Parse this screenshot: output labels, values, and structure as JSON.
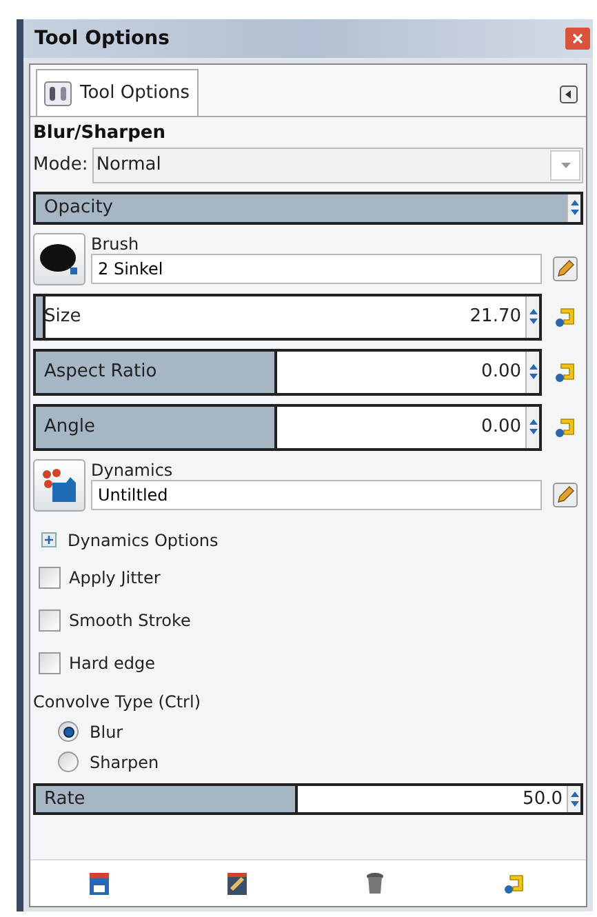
{
  "window": {
    "title": "Tool Options"
  },
  "tab": {
    "label": "Tool Options",
    "selected": true
  },
  "tool_name": "Blur/Sharpen",
  "mode": {
    "label": "Mode:",
    "value": "Normal"
  },
  "opacity": {
    "label": "Opacity",
    "level": 1
  },
  "brush": {
    "label": "Brush",
    "value": "2 Sinkel"
  },
  "sliders": [
    {
      "label": "Size",
      "value": "21.70",
      "level": 0.02
    },
    {
      "label": "Aspect Ratio",
      "value": "0.00",
      "level": 0.48
    },
    {
      "label": "Angle",
      "value": "0.00",
      "level": 0.48
    }
  ],
  "dynamics": {
    "label": "Dynamics",
    "value": "Untiltled"
  },
  "dynamics_options": {
    "label": "Dynamics Options",
    "expanded": false
  },
  "checkboxes": [
    {
      "label": "Apply Jitter",
      "checked": false
    },
    {
      "label": "Smooth Stroke",
      "checked": false
    },
    {
      "label": "Hard edge",
      "checked": false
    }
  ],
  "convolve": {
    "label": "Convolve Type (Ctrl)",
    "options": [
      {
        "label": "Blur",
        "selected": true
      },
      {
        "label": "Sharpen",
        "selected": false
      }
    ]
  },
  "rate": {
    "label": "Rate",
    "value": "50.0",
    "level": 0.48
  }
}
